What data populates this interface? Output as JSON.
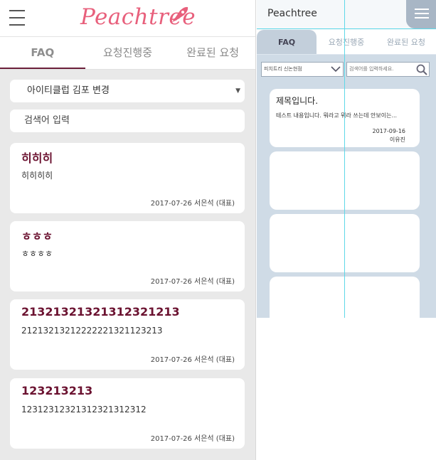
{
  "left": {
    "logo": "Peachtree",
    "tabs": [
      "FAQ",
      "요청진행중",
      "완료된 요청"
    ],
    "select_value": "아이티클럽 김포 변경",
    "search_placeholder": "검색어 입력",
    "cards": [
      {
        "title": "히히히",
        "body": "히히히히",
        "meta": "2017-07-26 서은석 (대표)"
      },
      {
        "title": "ㅎㅎㅎ",
        "body": "ㅎㅎㅎㅎ",
        "meta": "2017-07-26 서은석 (대표)"
      },
      {
        "title": "2132132132131232121​3",
        "body": "21213213212222221321123213",
        "meta": "2017-07-26 서은석 (대표)"
      },
      {
        "title": "123213213",
        "body": "12312312321312321312312",
        "meta": "2017-07-26 서은석 (대표)"
      }
    ]
  },
  "right": {
    "title": "Peachtree",
    "tabs": [
      "FAQ",
      "요청진행중",
      "완료된 요청"
    ],
    "select_value": "피치트리 신논현점",
    "search_placeholder": "검색어를 입력하세요.",
    "card": {
      "title": "제목입니다.",
      "body": "테스트 내용입니다. 뭐라고 뭐라 쓰는데 안보이는...",
      "date": "2017-09-16",
      "name": "이유진"
    }
  },
  "colors": {
    "accent": "#6b1230",
    "logo": "#e8607c",
    "right_bg": "#cfdbe6"
  }
}
